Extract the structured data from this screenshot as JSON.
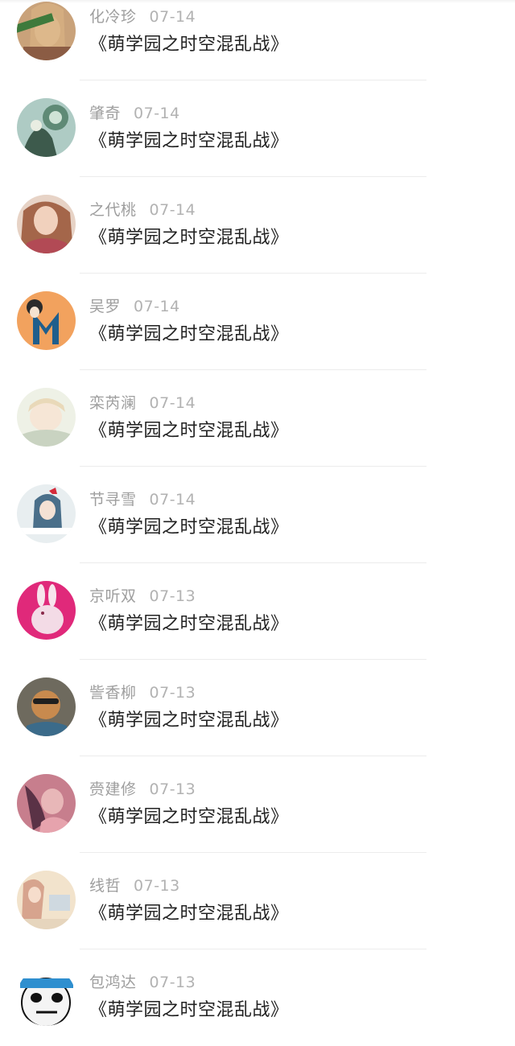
{
  "comments": [
    {
      "name": "化冷珍",
      "date": "07-14",
      "text": "《萌学园之时空混乱战》",
      "avatar_colors": [
        "#c9a27a",
        "#3e7a3c"
      ]
    },
    {
      "name": "肇奇",
      "date": "07-14",
      "text": "《萌学园之时空混乱战》",
      "avatar_colors": [
        "#7aa3a0",
        "#3d5a4c"
      ]
    },
    {
      "name": "之代桃",
      "date": "07-14",
      "text": "《萌学园之时空混乱战》",
      "avatar_colors": [
        "#d6a58f",
        "#b24a55"
      ]
    },
    {
      "name": "吴罗",
      "date": "07-14",
      "text": "《萌学园之时空混乱战》",
      "avatar_colors": [
        "#f2a25e",
        "#1f5e8c"
      ]
    },
    {
      "name": "栾芮澜",
      "date": "07-14",
      "text": "《萌学园之时空混乱战》",
      "avatar_colors": [
        "#eef1e6",
        "#c9d3c1"
      ]
    },
    {
      "name": "节寻雪",
      "date": "07-14",
      "text": "《萌学园之时空混乱战》",
      "avatar_colors": [
        "#e8eef0",
        "#4a6f8a"
      ]
    },
    {
      "name": "京听双",
      "date": "07-13",
      "text": "《萌学园之时空混乱战》",
      "avatar_colors": [
        "#e0297a",
        "#f3dbe6"
      ]
    },
    {
      "name": "訾香柳",
      "date": "07-13",
      "text": "《萌学园之时空混乱战》",
      "avatar_colors": [
        "#a8662f",
        "#3b3b3b"
      ]
    },
    {
      "name": "赍建修",
      "date": "07-13",
      "text": "《萌学园之时空混乱战》",
      "avatar_colors": [
        "#c77e8d",
        "#5a3246"
      ]
    },
    {
      "name": "线哲",
      "date": "07-13",
      "text": "《萌学园之时空混乱战》",
      "avatar_colors": [
        "#f2e3cc",
        "#d7a48e"
      ]
    },
    {
      "name": "包鸿达",
      "date": "07-13",
      "text": "《萌学园之时空混乱战》",
      "avatar_colors": [
        "#2f8fcf",
        "#ffffff"
      ]
    }
  ]
}
